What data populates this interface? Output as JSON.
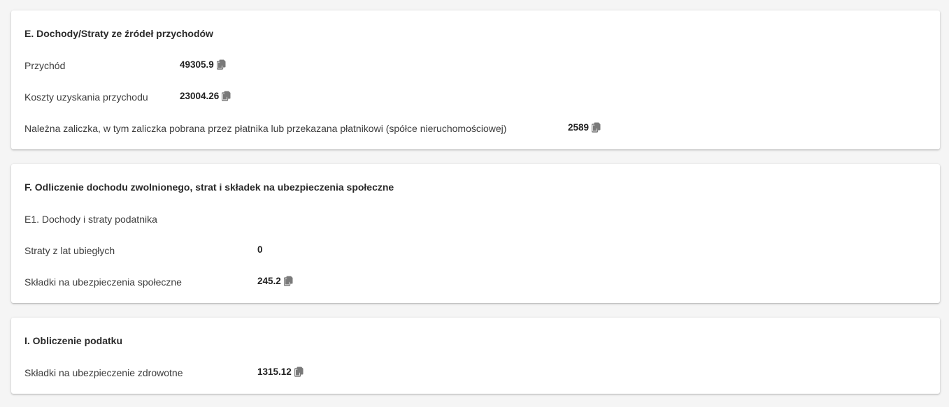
{
  "sections": [
    {
      "title": "E. Dochody/Straty ze źródeł przychodów",
      "rows": [
        {
          "label": "Przychód",
          "value": "49305.9",
          "copyable": true
        },
        {
          "label": "Koszty uzyskania przychodu",
          "value": "23004.26",
          "copyable": true
        },
        {
          "label": "Należna zaliczka, w tym zaliczka pobrana przez płatnika lub przekazana płatnikowi (spółce nieruchomościowej)",
          "value": "2589",
          "copyable": true
        }
      ]
    },
    {
      "title": "F. Odliczenie dochodu zwolnionego, strat i składek na ubezpieczenia społeczne",
      "rows": [
        {
          "label": "E1. Dochody i straty podatnika",
          "value": "",
          "copyable": false
        },
        {
          "label": "Straty z lat ubiegłych",
          "value": "0",
          "copyable": false
        },
        {
          "label": "Składki na ubezpieczenia społeczne",
          "value": "245.2",
          "copyable": true
        }
      ]
    },
    {
      "title": "I. Obliczenie podatku",
      "rows": [
        {
          "label": "Składki na ubezpieczenie zdrowotne",
          "value": "1315.12",
          "copyable": true
        }
      ]
    }
  ],
  "icons": {
    "copy": "copy-icon"
  },
  "colors": {
    "background": "#f5f5f5",
    "card": "#ffffff",
    "icon": "#7a7a7a"
  }
}
